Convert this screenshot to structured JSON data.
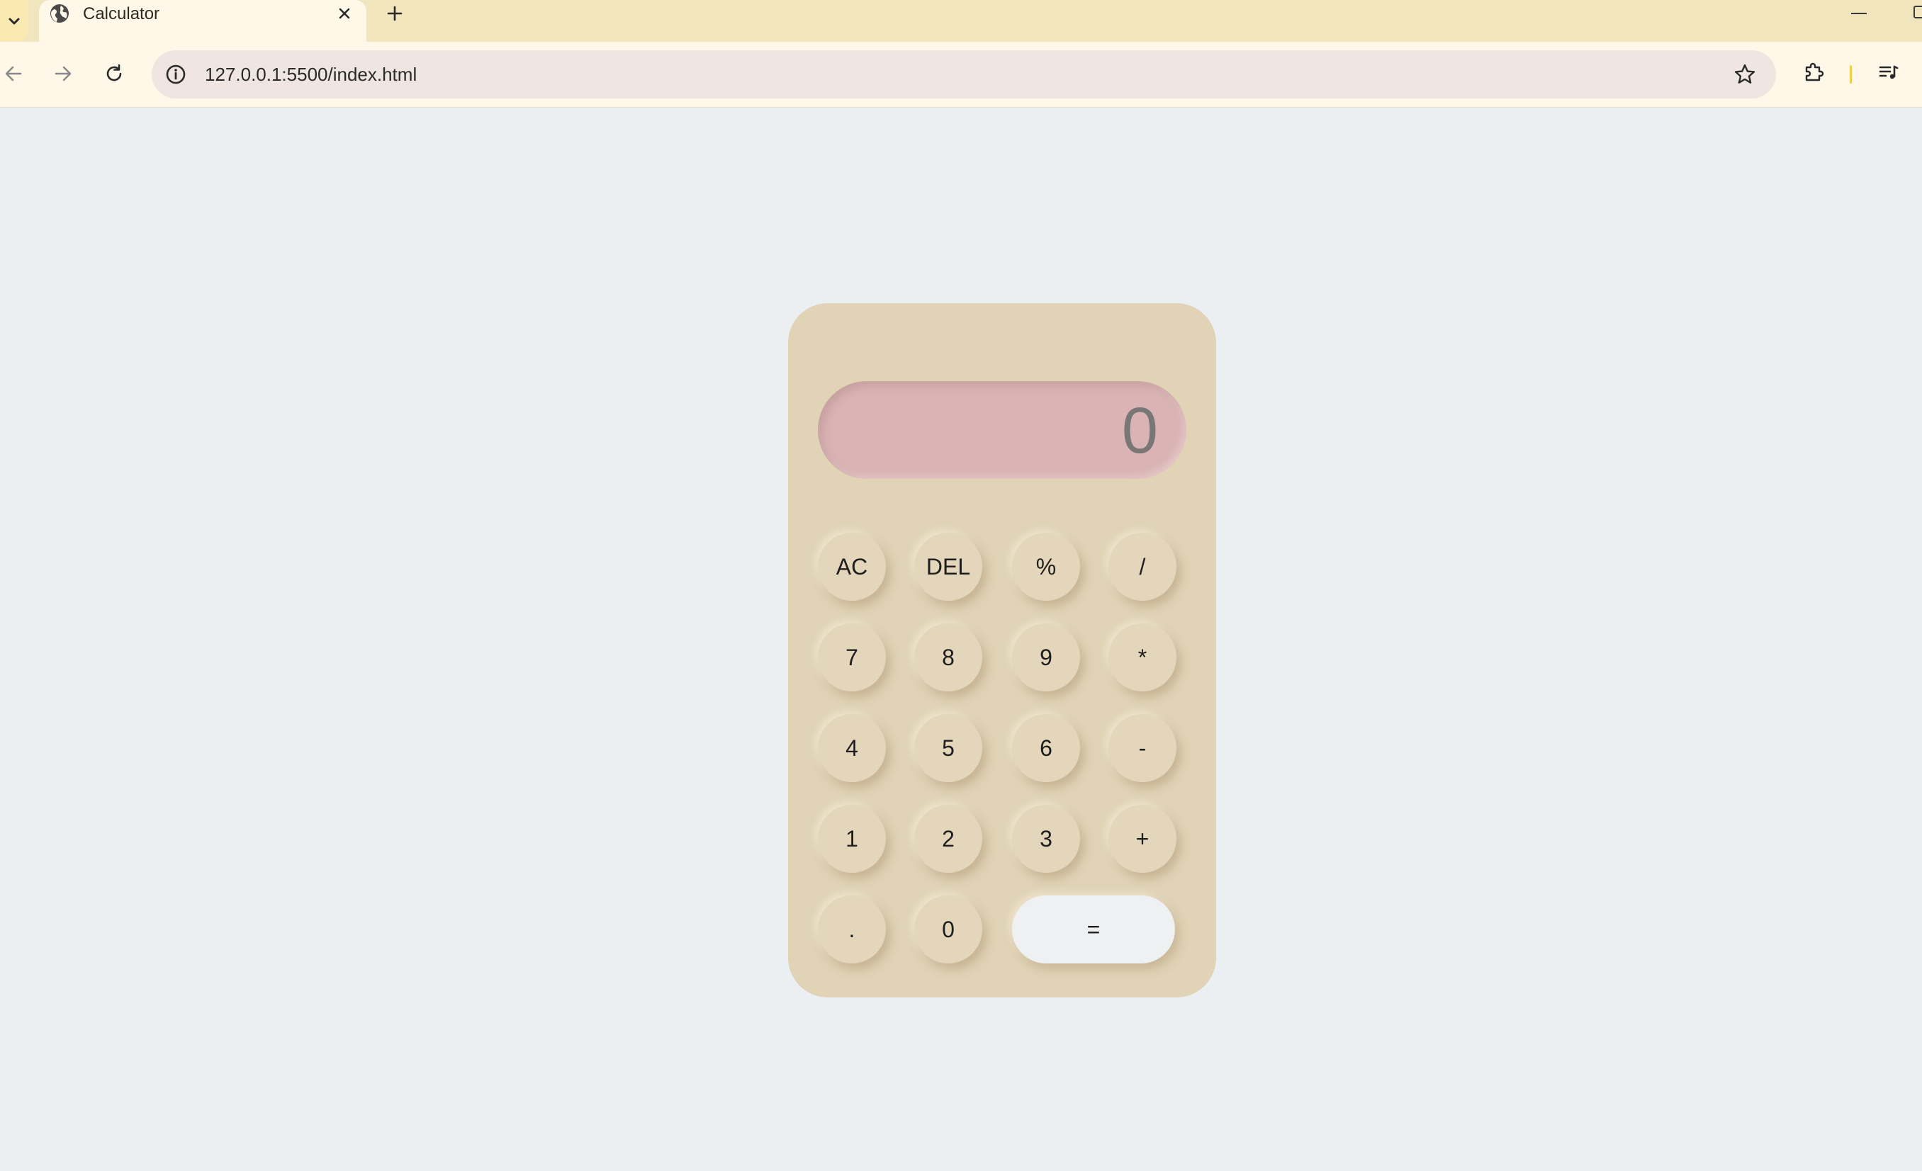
{
  "browser": {
    "tab": {
      "title": "Calculator",
      "favicon": "globe-icon"
    },
    "address": {
      "url": "127.0.0.1:5500/index.html"
    },
    "accent_color": "#f2cf4a"
  },
  "calculator": {
    "display": "0",
    "keys": {
      "ac": "AC",
      "del": "DEL",
      "percent": "%",
      "divide": "/",
      "seven": "7",
      "eight": "8",
      "nine": "9",
      "multiply": "*",
      "four": "4",
      "five": "5",
      "six": "6",
      "minus": "-",
      "one": "1",
      "two": "2",
      "three": "3",
      "plus": "+",
      "decimal": ".",
      "zero": "0",
      "equals": "="
    },
    "colors": {
      "body": "#e0d3b6",
      "display": "#dab4b4",
      "equals": "#eef0f2"
    }
  }
}
